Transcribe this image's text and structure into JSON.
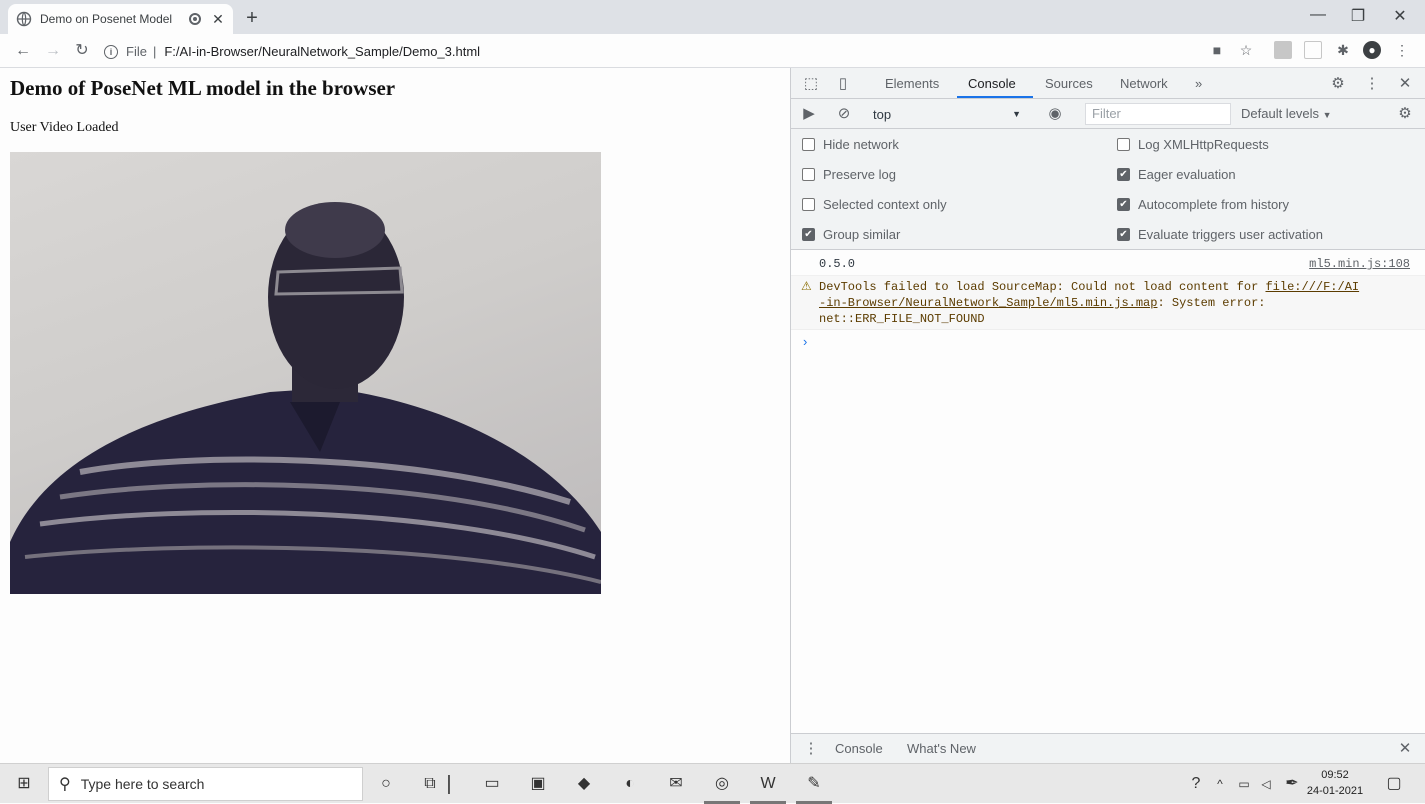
{
  "browser": {
    "tab_title": "Demo on Posenet Model",
    "tab_close": "✕",
    "new_tab": "+",
    "address_scheme": "File",
    "address_separator": "|",
    "address_url": "F:/AI-in-Browser/NeuralNetwork_Sample/Demo_3.html"
  },
  "page": {
    "heading": "Demo of PoseNet ML model in the browser",
    "status_text": "User Video Loaded"
  },
  "devtools": {
    "tabs": [
      "Elements",
      "Console",
      "Sources",
      "Network"
    ],
    "active_tab": "Console",
    "more_tabs": "»",
    "context": "top",
    "filter_placeholder": "Filter",
    "levels": "Default levels",
    "options_left": [
      {
        "label": "Hide network",
        "checked": false
      },
      {
        "label": "Preserve log",
        "checked": false
      },
      {
        "label": "Selected context only",
        "checked": false
      },
      {
        "label": "Group similar",
        "checked": true
      }
    ],
    "options_right": [
      {
        "label": "Log XMLHttpRequests",
        "checked": false
      },
      {
        "label": "Eager evaluation",
        "checked": true
      },
      {
        "label": "Autocomplete from history",
        "checked": true
      },
      {
        "label": "Evaluate triggers user activation",
        "checked": true
      }
    ],
    "log_value": "0.5.0",
    "log_source": "ml5.min.js:108",
    "warn_text_1": "DevTools failed to load SourceMap: Could not load content for ",
    "warn_link_1": "file:///F:/AI",
    "warn_link_2": "-in-Browser/NeuralNetwork_Sample/ml5.min.js.map",
    "warn_text_2": ": System error:",
    "warn_text_3": "net::ERR_FILE_NOT_FOUND",
    "prompt": "›",
    "drawer_tabs": [
      "Console",
      "What's New"
    ]
  },
  "taskbar": {
    "search_placeholder": "Type here to search",
    "time": "09:52",
    "date": "24-01-2021"
  }
}
